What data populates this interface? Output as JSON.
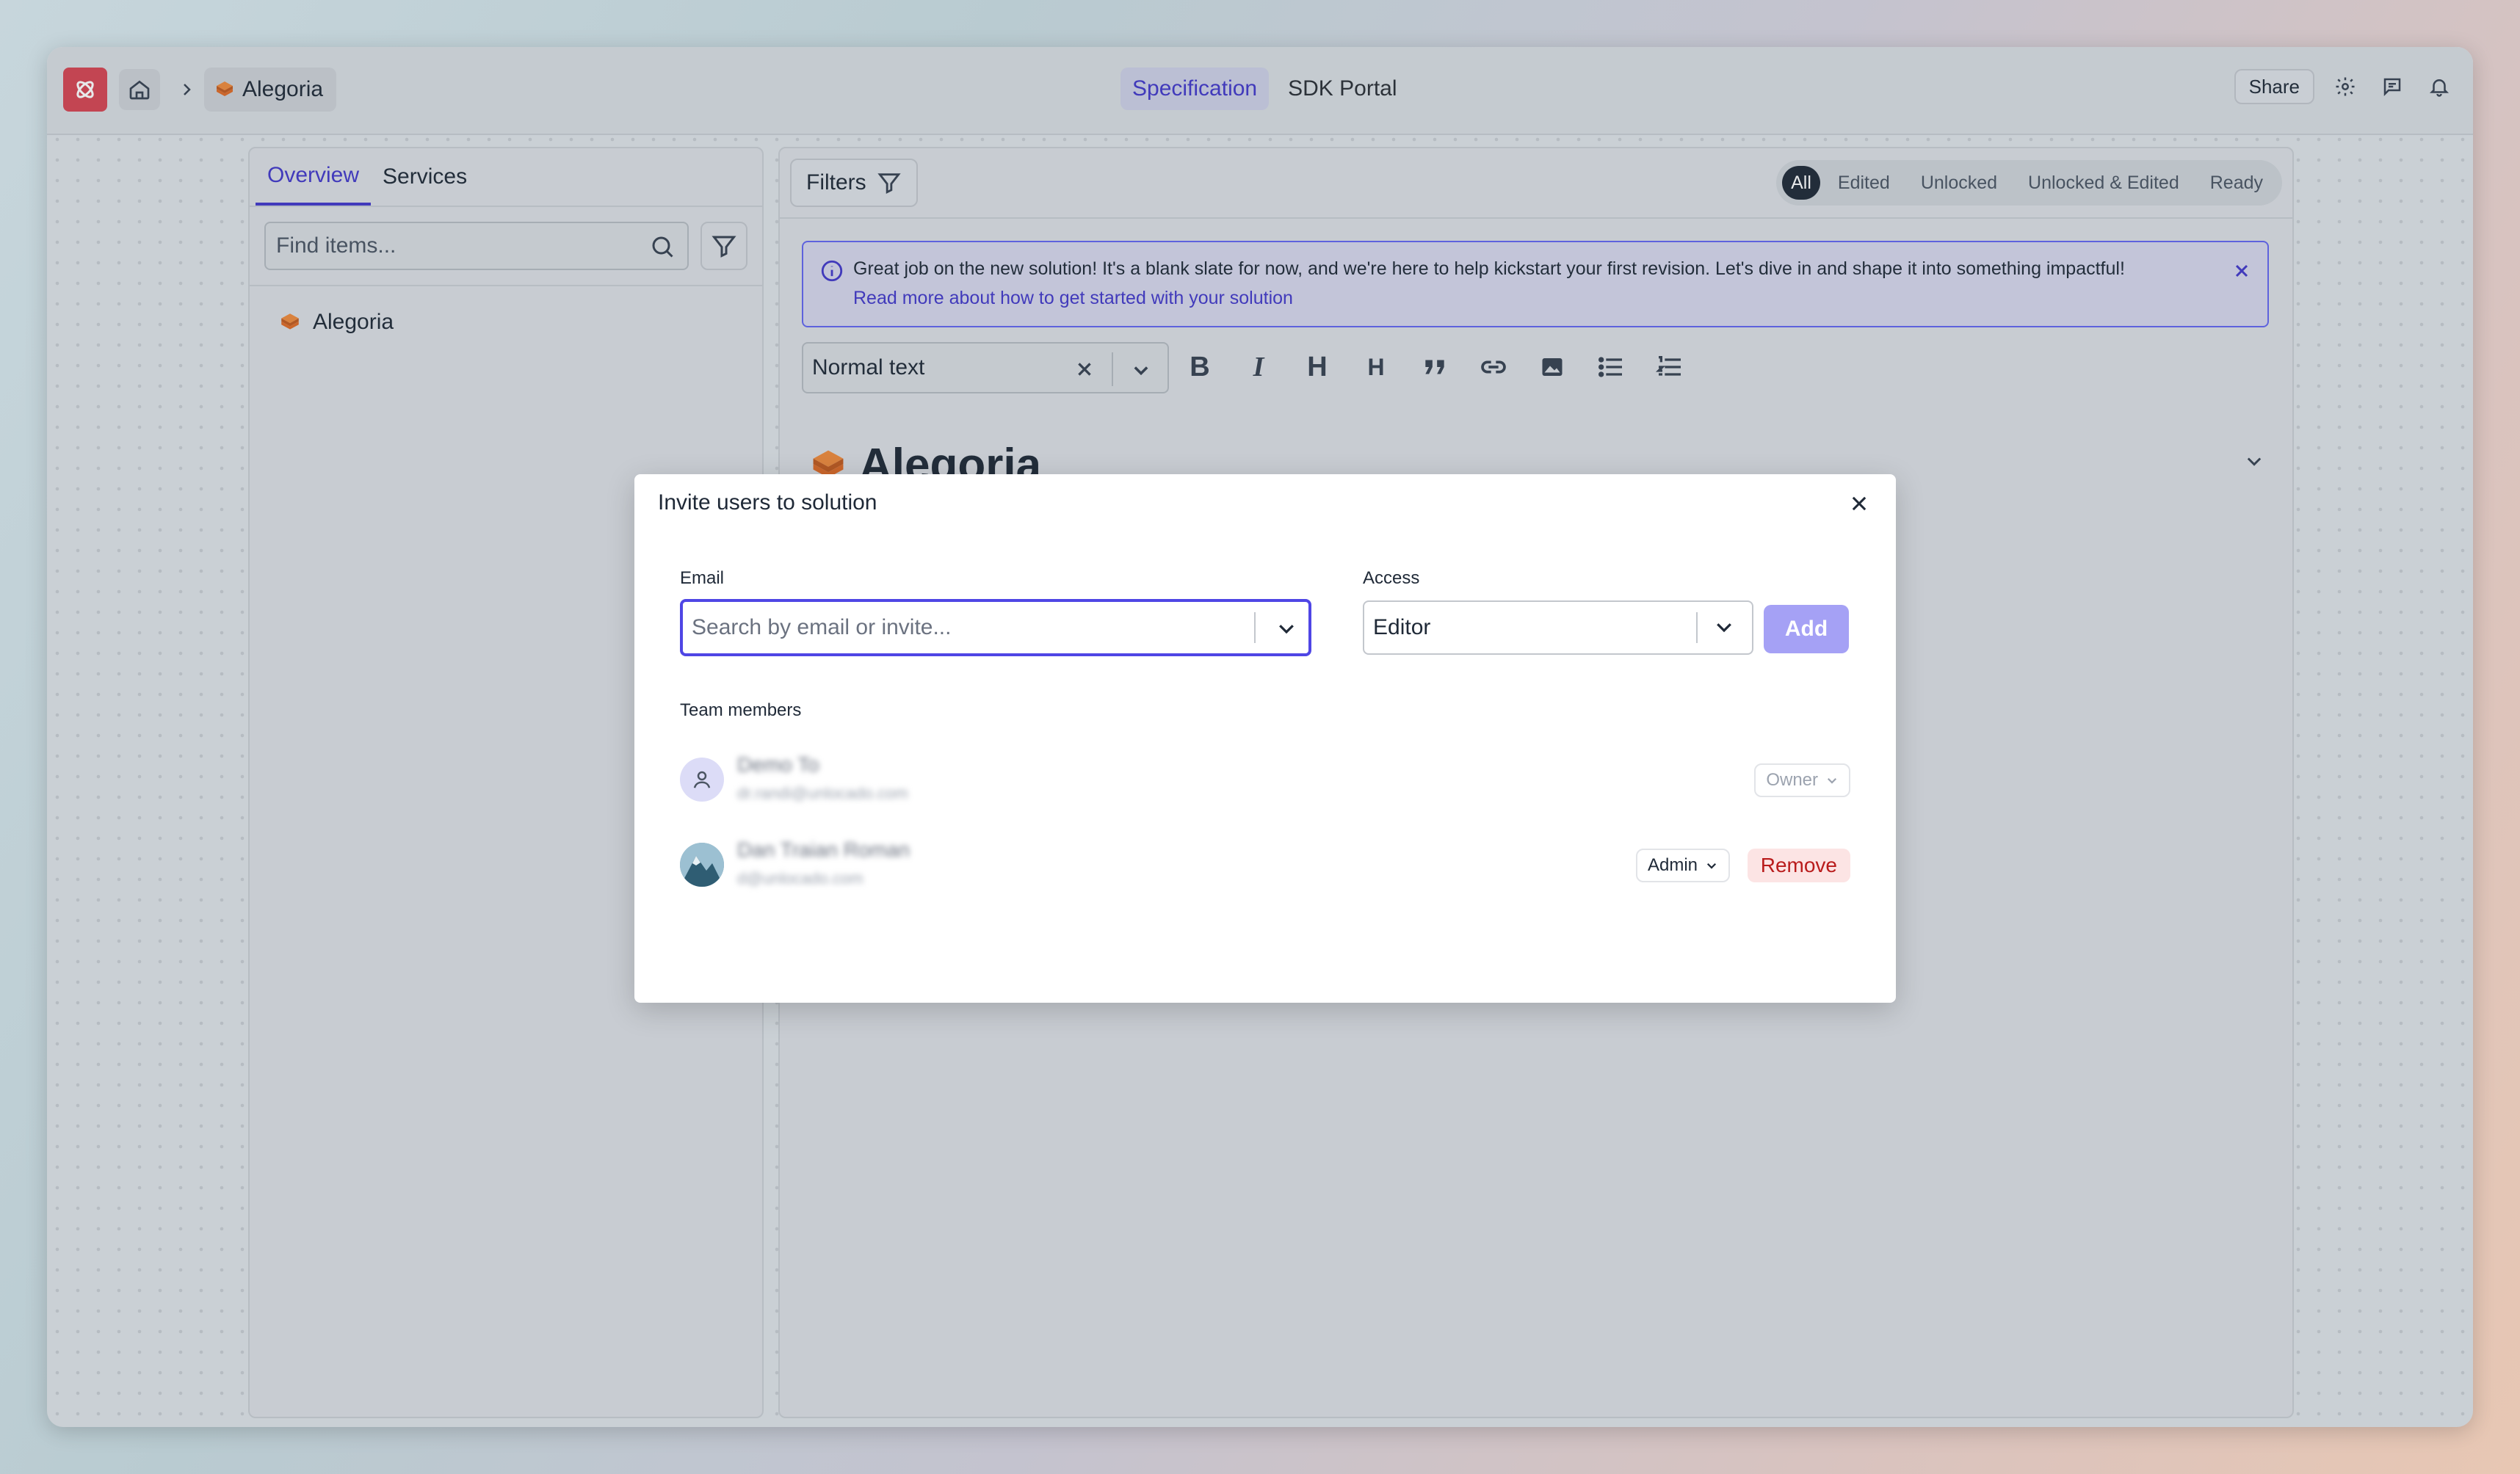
{
  "topbar": {
    "breadcrumb_project": "Alegoria",
    "tabs": [
      {
        "label": "Specification",
        "active": true
      },
      {
        "label": "SDK Portal",
        "active": false
      }
    ],
    "share_label": "Share",
    "icons": [
      "home-icon",
      "chevron-right-icon",
      "gear-icon",
      "comment-icon",
      "bell-icon"
    ]
  },
  "sidebar": {
    "tabs": [
      {
        "label": "Overview",
        "active": true
      },
      {
        "label": "Services",
        "active": false
      }
    ],
    "search": {
      "placeholder": "Find items..."
    },
    "tree": [
      {
        "label": "Alegoria"
      }
    ]
  },
  "editor": {
    "filters_label": "Filters",
    "segments": [
      {
        "label": "All",
        "active": true
      },
      {
        "label": "Edited",
        "active": false
      },
      {
        "label": "Unlocked",
        "active": false
      },
      {
        "label": "Unlocked & Edited",
        "active": false
      },
      {
        "label": "Ready",
        "active": false
      }
    ],
    "banner": {
      "message": "Great job on the new solution! It's a blank slate for now, and we're here to help kickstart your first revision. Let's dive in and shape it into something impactful!",
      "link": "Read more about how to get started with your solution"
    },
    "format": {
      "value": "Normal text"
    },
    "toolbar": [
      "bold-icon",
      "italic-icon",
      "heading-1-icon",
      "heading-2-icon",
      "quote-icon",
      "link-icon",
      "image-icon",
      "bullet-list-icon",
      "numbered-list-icon"
    ],
    "doc_title": "Alegoria"
  },
  "modal": {
    "title": "Invite users to solution",
    "email_label": "Email",
    "email_placeholder": "Search by email or invite...",
    "access_label": "Access",
    "access_value": "Editor",
    "add_label": "Add",
    "team_label": "Team members",
    "members": [
      {
        "name": "Demo To",
        "email": "dr.randi@unlocado.com",
        "role": "Owner"
      },
      {
        "name": "Dan Traian Roman",
        "email": "d@unlocado.com",
        "role": "Admin",
        "action": "Remove"
      }
    ]
  },
  "colors": {
    "accent": "#4f46e5",
    "brand": "#d64552",
    "add_button": "#a5a1f5",
    "remove_bg": "#fce4e4",
    "remove_text": "#b91c1c"
  }
}
